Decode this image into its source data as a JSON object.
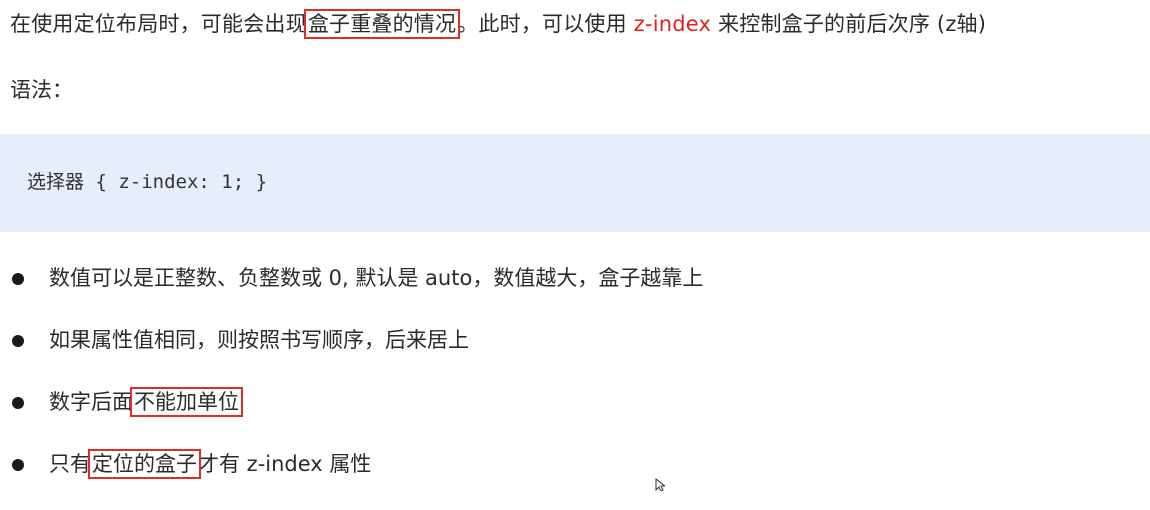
{
  "intro": {
    "part1": "在使用定位布局时，可能会出现",
    "boxed": "盒子重叠的情况",
    "part2": "。此时，可以使用 ",
    "accent": "z-index",
    "part3": " 来控制盒子的前后次序 (z轴)"
  },
  "syntax_label": "语法：",
  "code": "选择器 { z-index: 1; }",
  "bullets": [
    {
      "before": "数值可以是正整数、负整数或 0, 默认是 auto，数值越大，盒子越靠上",
      "boxed": "",
      "after": ""
    },
    {
      "before": "如果属性值相同，则按照书写顺序，后来居上",
      "boxed": "",
      "after": ""
    },
    {
      "before": "数字后面",
      "boxed": "不能加单位",
      "after": ""
    },
    {
      "before": "只有",
      "boxed": "定位的盒子",
      "after": "才有 z-index 属性"
    }
  ],
  "colors": {
    "accent": "#e2231a",
    "highlight_box": "#d9302c",
    "code_background": "#e6eefc",
    "text": "#2b2b2b"
  },
  "icons": {
    "cursor": "mouse-pointer-icon"
  }
}
